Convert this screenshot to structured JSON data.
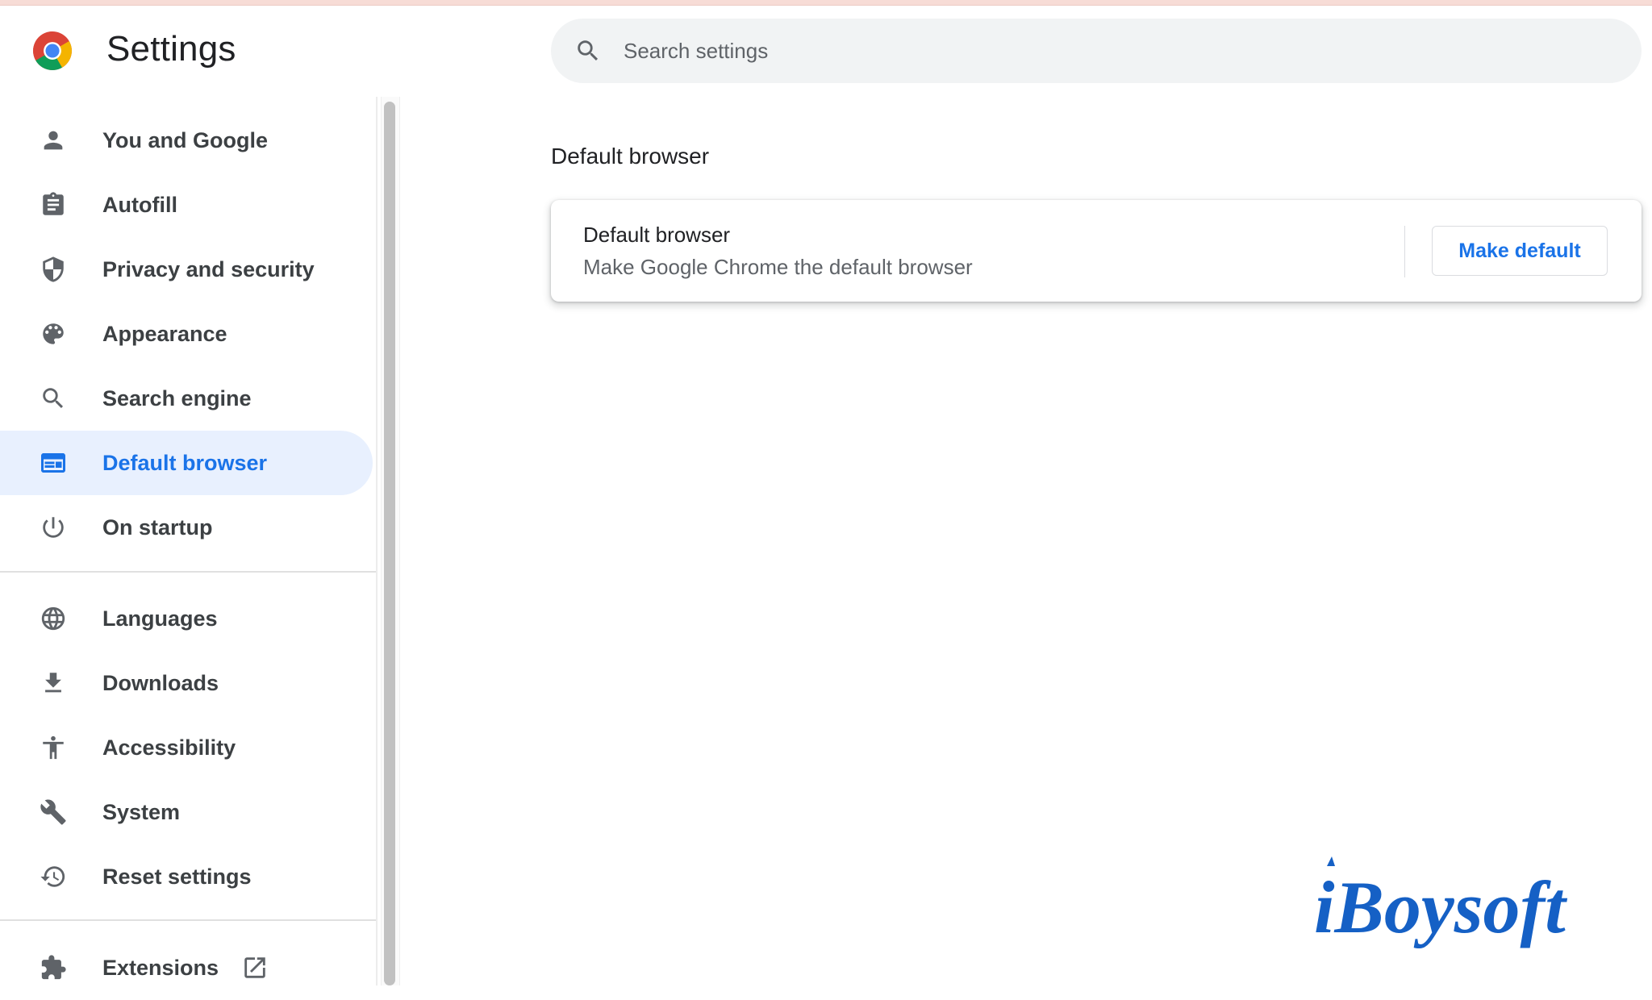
{
  "header": {
    "title": "Settings",
    "search_placeholder": "Search settings"
  },
  "sidebar": {
    "items": [
      {
        "label": "You and Google",
        "icon": "person-icon"
      },
      {
        "label": "Autofill",
        "icon": "clipboard-icon"
      },
      {
        "label": "Privacy and security",
        "icon": "shield-icon"
      },
      {
        "label": "Appearance",
        "icon": "palette-icon"
      },
      {
        "label": "Search engine",
        "icon": "search-icon"
      },
      {
        "label": "Default browser",
        "icon": "browser-window-icon",
        "active": true
      },
      {
        "label": "On startup",
        "icon": "power-icon"
      },
      {
        "label": "Languages",
        "icon": "globe-icon"
      },
      {
        "label": "Downloads",
        "icon": "download-icon"
      },
      {
        "label": "Accessibility",
        "icon": "accessibility-icon"
      },
      {
        "label": "System",
        "icon": "wrench-icon"
      },
      {
        "label": "Reset settings",
        "icon": "history-reset-icon"
      },
      {
        "label": "Extensions",
        "icon": "puzzle-icon",
        "trailing_icon": "open-in-new-icon"
      }
    ]
  },
  "main": {
    "section_title": "Default browser",
    "card": {
      "title": "Default browser",
      "subtitle": "Make Google Chrome the default browser",
      "button_label": "Make default"
    }
  },
  "watermark": {
    "text": "iBoysoft"
  },
  "colors": {
    "accent": "#1a73e8",
    "active_bg": "#e8f0fe",
    "icon": "#5f6368",
    "text": "#3c4043",
    "watermark": "#1560c5"
  }
}
